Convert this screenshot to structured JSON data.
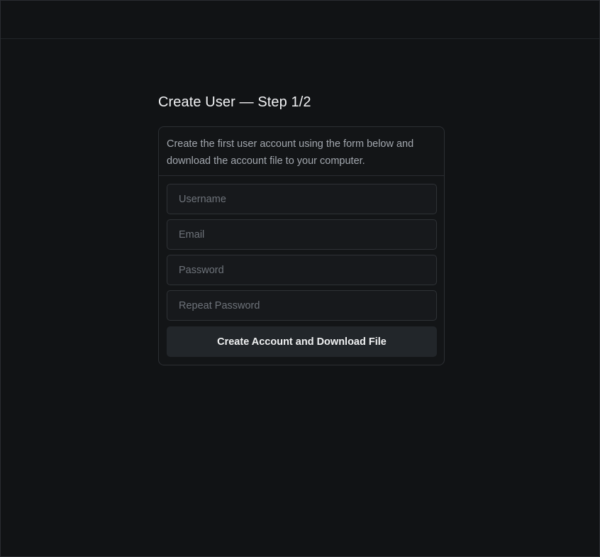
{
  "page": {
    "title": "Create User — Step 1/2"
  },
  "card": {
    "description": "Create the first user account using the form below and download the account file to your computer."
  },
  "form": {
    "username_placeholder": "Username",
    "username_value": "",
    "email_placeholder": "Email",
    "email_value": "",
    "password_placeholder": "Password",
    "password_value": "",
    "repeat_password_placeholder": "Repeat Password",
    "repeat_password_value": "",
    "submit_label": "Create Account and Download File"
  },
  "colors": {
    "background": "#111315",
    "card_border": "#2c2f33",
    "input_bg": "#17191c",
    "button_bg": "#22262a",
    "text_primary": "#f2f3f5",
    "text_muted": "#a2a7ae"
  }
}
